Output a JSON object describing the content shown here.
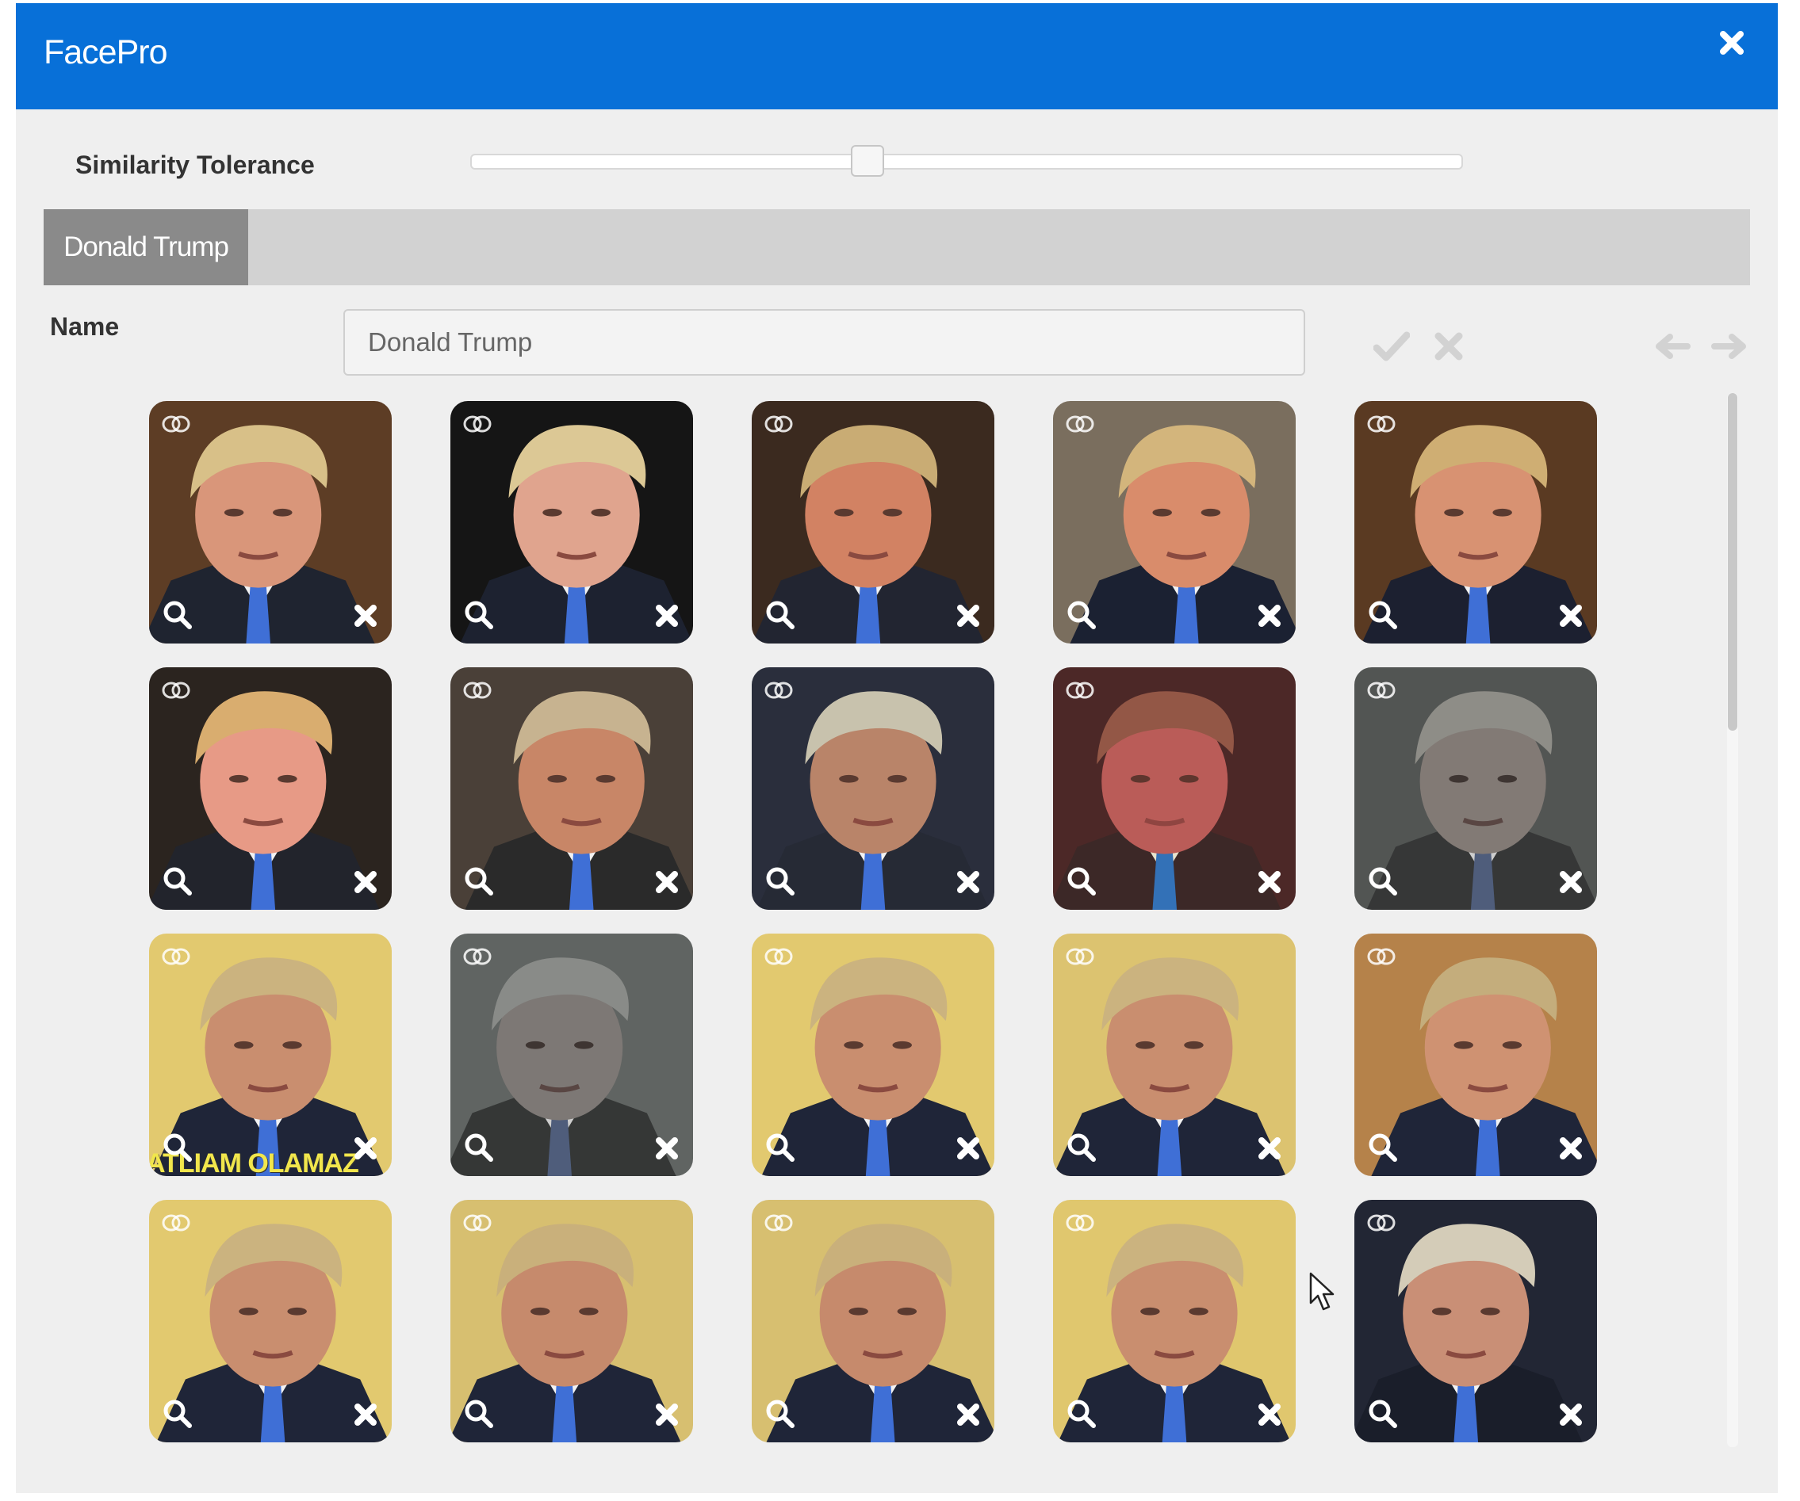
{
  "app": {
    "title": "FacePro",
    "close_icon": "close-icon",
    "accent": "#0870d8"
  },
  "tolerance": {
    "label": "Similarity Tolerance",
    "value": 0.4
  },
  "tabs": [
    {
      "label": "Donald Trump",
      "active": true
    }
  ],
  "name_field": {
    "label": "Name",
    "value": "Donald Trump"
  },
  "actions": {
    "confirm_icon": "checkmark-icon",
    "cancel_icon": "cancel-x-icon",
    "prev_icon": "arrow-left-icon",
    "next_icon": "arrow-right-icon"
  },
  "faces": [
    {
      "bg": "#5d3d25",
      "skin": "#d9967a",
      "hair": "#d8c088",
      "suit": "#1f2430",
      "tone": "normal"
    },
    {
      "bg": "#151515",
      "skin": "#e0a48e",
      "hair": "#dcc895",
      "suit": "#1d2230",
      "tone": "normal"
    },
    {
      "bg": "#3b2a1f",
      "skin": "#d28263",
      "hair": "#c9ac74",
      "suit": "#222531",
      "tone": "normal"
    },
    {
      "bg": "#7a6e5e",
      "skin": "#d98c6b",
      "hair": "#d3b57c",
      "suit": "#1b2132",
      "tone": "normal"
    },
    {
      "bg": "#5a3a22",
      "skin": "#d89272",
      "hair": "#cfae73",
      "suit": "#1c2030",
      "tone": "normal"
    },
    {
      "bg": "#2b241f",
      "skin": "#e79a86",
      "hair": "#d9ad6f",
      "suit": "#22242c",
      "tone": "normal"
    },
    {
      "bg": "#4a4038",
      "skin": "#c88667",
      "hair": "#c7b390",
      "suit": "#2a2a2a",
      "tone": "normal"
    },
    {
      "bg": "#2a2e3c",
      "skin": "#b98469",
      "hair": "#c8c2ad",
      "suit": "#262a35",
      "tone": "normal"
    },
    {
      "bg": "#4a2a28",
      "skin": "#b36258",
      "hair": "#8c5e4a",
      "suit": "#3a2a2a",
      "tone": "red"
    },
    {
      "bg": "#5c6560",
      "skin": "#a88d7c",
      "hair": "#a9a693",
      "suit": "#3c4240",
      "tone": "gray"
    },
    {
      "bg": "#e2c96f",
      "skin": "#c98e6f",
      "hair": "#cbb37f",
      "suit": "#1f2538",
      "tone": "normal",
      "caption": "ATLIAM OLAMAZ"
    },
    {
      "bg": "#6c7772",
      "skin": "#9b8c80",
      "hair": "#9ea59b",
      "suit": "#3a4240",
      "tone": "gray"
    },
    {
      "bg": "#e2c96f",
      "skin": "#c98e6f",
      "hair": "#cbb37f",
      "suit": "#1f2538",
      "tone": "normal"
    },
    {
      "bg": "#dcc370",
      "skin": "#c98e6f",
      "hair": "#cbb37f",
      "suit": "#1f2538",
      "tone": "normal"
    },
    {
      "bg": "#b5824a",
      "skin": "#cf9272",
      "hair": "#c4ad7c",
      "suit": "#1f2538",
      "tone": "normal"
    },
    {
      "bg": "#e2c96f",
      "skin": "#c98e6f",
      "hair": "#cbb37f",
      "suit": "#1f2538",
      "tone": "normal"
    },
    {
      "bg": "#d7bf70",
      "skin": "#c68a6c",
      "hair": "#c9b07b",
      "suit": "#1f2538",
      "tone": "normal"
    },
    {
      "bg": "#d7bf70",
      "skin": "#c68a6c",
      "hair": "#c9b07b",
      "suit": "#1f2538",
      "tone": "normal"
    },
    {
      "bg": "#e0c76e",
      "skin": "#c98e6f",
      "hair": "#cbb37f",
      "suit": "#1f2538",
      "tone": "normal"
    },
    {
      "bg": "#222634",
      "skin": "#c98f76",
      "hair": "#d4ccb8",
      "suit": "#1a1e2a",
      "tone": "normal"
    }
  ],
  "face_overlay_icons": {
    "link": "linked-rings-icon",
    "zoom": "magnifier-icon",
    "remove": "remove-x-icon"
  },
  "scroll": {
    "position": 0.0,
    "visible_fraction": 0.32
  }
}
